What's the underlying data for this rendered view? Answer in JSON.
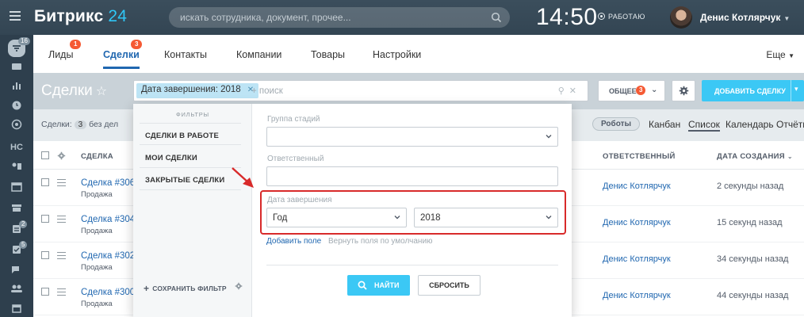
{
  "header": {
    "logo_brand": "Битрикс",
    "logo_number": "24",
    "search_placeholder": "искать сотрудника, документ, прочее...",
    "time": "14:50",
    "work_status": "РАБОТАЮ",
    "user_name": "Денис Котлярчук"
  },
  "leftbar": {
    "badges": {
      "filter": "16",
      "tasks": "2",
      "checks": "5"
    },
    "hc_label": "HC"
  },
  "tabs": [
    {
      "label": "Лиды",
      "badge": "1"
    },
    {
      "label": "Сделки",
      "badge": "3"
    },
    {
      "label": "Контакты"
    },
    {
      "label": "Компании"
    },
    {
      "label": "Товары"
    },
    {
      "label": "Настройки"
    }
  ],
  "more_label": "Еще",
  "toolbar": {
    "page_title": "Сделки",
    "filter_chip": "Дата завершения: 2018",
    "filter_placeholder": "+ поиск",
    "general_label": "ОБЩЕЕ",
    "general_count": "3",
    "add_deal_label": "ДОБАВИТЬ СДЕЛКУ"
  },
  "subbar": {
    "deals_prefix": "Сделки:",
    "deals_count": "3",
    "deals_suffix": "без дел",
    "robots": "Роботы",
    "views": [
      "Канбан",
      "Список",
      "Календарь",
      "Отчёты"
    ]
  },
  "table": {
    "columns": {
      "deal": "СДЕЛКА",
      "responsible": "ОТВЕТСТВЕННЫЙ",
      "created": "ДАТА СОЗДАНИЯ"
    },
    "rows": [
      {
        "name": "Сделка #306",
        "stage": "Продажа",
        "responsible": "Денис Котлярчук",
        "created": "2 секунды назад"
      },
      {
        "name": "Сделка #304",
        "stage": "Продажа",
        "responsible": "Денис Котлярчук",
        "created": "15 секунд назад"
      },
      {
        "name": "Сделка #302",
        "stage": "Продажа",
        "responsible": "Денис Котлярчук",
        "created": "34 секунды назад"
      },
      {
        "name": "Сделка #300",
        "stage": "Продажа",
        "responsible": "Денис Котлярчук",
        "created": "44 секунды назад"
      }
    ]
  },
  "filter_popup": {
    "presets_title": "ФИЛЬТРЫ",
    "presets": [
      "СДЕЛКИ В РАБОТЕ",
      "МОИ СДЕЛКИ",
      "ЗАКРЫТЫЕ СДЕЛКИ"
    ],
    "save_filter": "СОХРАНИТЬ ФИЛЬТР",
    "fields": {
      "stage_group": {
        "label": "Группа стадий",
        "value": ""
      },
      "responsible": {
        "label": "Ответственный",
        "value": ""
      },
      "close_date": {
        "label": "Дата завершения",
        "period": "Год",
        "year": "2018"
      }
    },
    "add_field": "Добавить поле",
    "restore_fields": "Вернуть поля по умолчанию",
    "find": "НАЙТИ",
    "reset": "СБРОСИТЬ"
  },
  "colors": {
    "accent": "#3bc8f5",
    "link": "#2067b0",
    "highlight_frame": "#d82a2a",
    "badge": "#f55a34"
  }
}
